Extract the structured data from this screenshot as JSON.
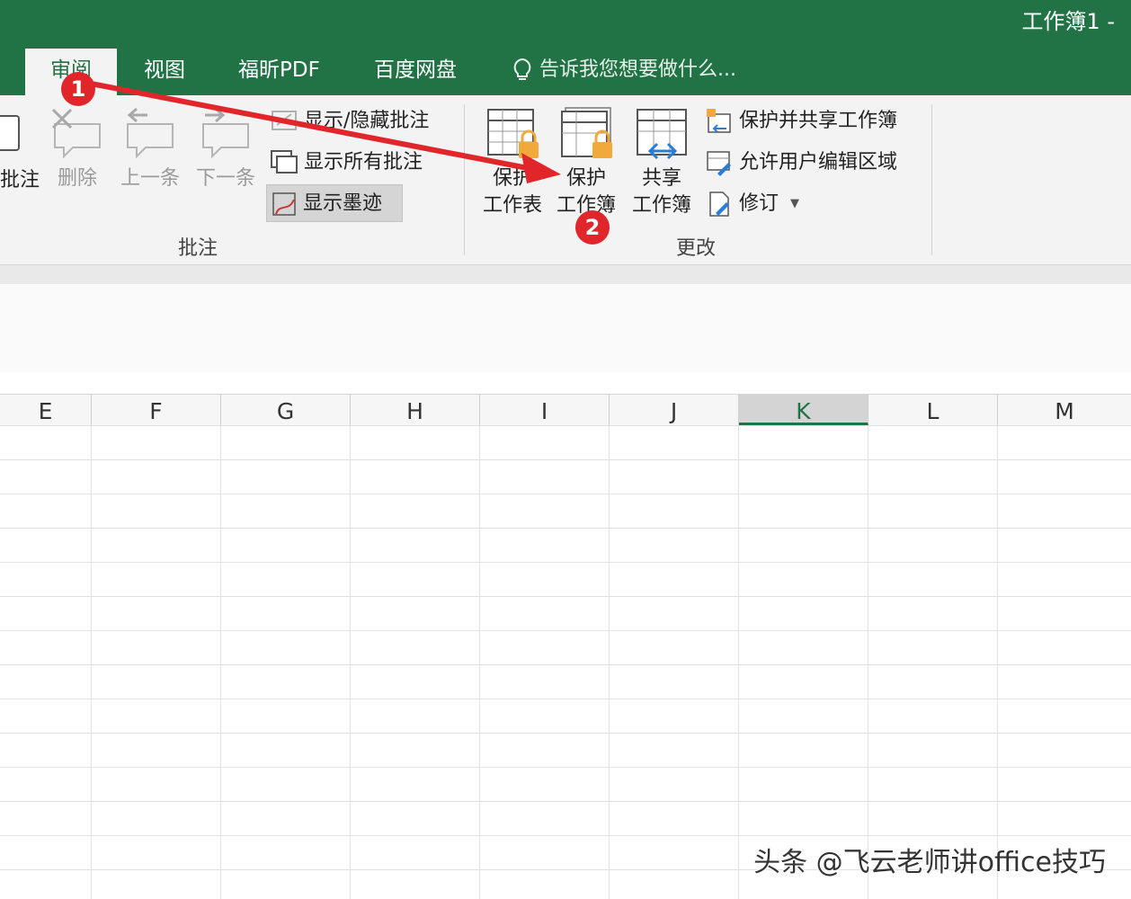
{
  "window": {
    "title": "工作簿1 -"
  },
  "tabs": {
    "review": "审阅",
    "view": "视图",
    "foxit": "福昕PDF",
    "baidu": "百度网盘",
    "tell_me": "告诉我您想要做什么..."
  },
  "ribbon": {
    "comments": {
      "new_comment_partial": "批注",
      "delete": "删除",
      "previous": "上一条",
      "next": "下一条",
      "show_hide_comment": "显示/隐藏批注",
      "show_all_comments": "显示所有批注",
      "show_ink": "显示墨迹",
      "group_label": "批注"
    },
    "changes": {
      "protect_sheet_line1": "保护",
      "protect_sheet_line2": "工作表",
      "protect_workbook_line1": "保护",
      "protect_workbook_line2": "工作簿",
      "share_workbook_line1": "共享",
      "share_workbook_line2": "工作簿",
      "protect_share_workbook": "保护并共享工作簿",
      "allow_edit_ranges": "允许用户编辑区域",
      "track_changes": "修订",
      "group_label": "更改"
    }
  },
  "grid": {
    "columns": [
      "E",
      "F",
      "G",
      "H",
      "I",
      "J",
      "K",
      "L",
      "M"
    ],
    "selected_column": "K"
  },
  "annotations": {
    "step1": "1",
    "step2": "2",
    "arrow_color": "#e0262a"
  },
  "watermark": "头条 @飞云老师讲office技巧",
  "colors": {
    "accent": "#217346",
    "ribbon_bg": "#f3f3f3"
  }
}
